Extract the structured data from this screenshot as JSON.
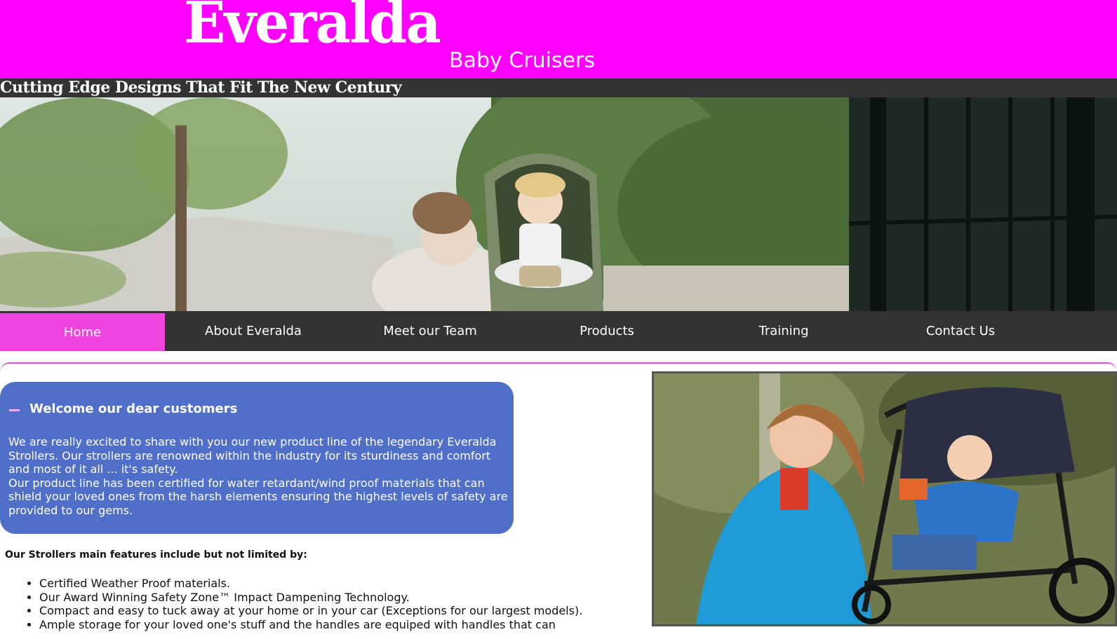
{
  "header": {
    "logo": "Everalda",
    "sub_logo": "Baby Cruisers",
    "background_color": "#ff00ff"
  },
  "tagline": "Cutting Edge Designs That Fit The New Century",
  "nav": {
    "items": [
      {
        "label": "Home"
      },
      {
        "label": "About Everalda"
      },
      {
        "label": "Meet our Team"
      },
      {
        "label": "Products"
      },
      {
        "label": "Training"
      },
      {
        "label": "Contact Us"
      }
    ],
    "active_color": "#ee44dd"
  },
  "welcome": {
    "title": "Welcome our dear customers",
    "paragraph1": "We are really excited to share with you our new product line of the legendary Everalda Strollers. Our strollers are renowned within the industry for its sturdiness and comfort and most of it all ... it's safety.",
    "paragraph2": "Our product line has been certified for water retardant/wind proof materials that can shield your loved ones from the harsh elements ensuring the highest levels of safety are provided to our gems.",
    "background_color": "#4f6fc8"
  },
  "features": {
    "heading": "Our Strollers main features include but not limited by:",
    "items": [
      "Certified Weather Proof materials.",
      "Our Award Winning Safety Zone™ Impact Dampening Technology.",
      "Compact and easy to tuck away at your home or in your car (Exceptions for our largest models).",
      "Ample storage for your loved one's stuff and the handles are equiped with handles that can"
    ]
  }
}
